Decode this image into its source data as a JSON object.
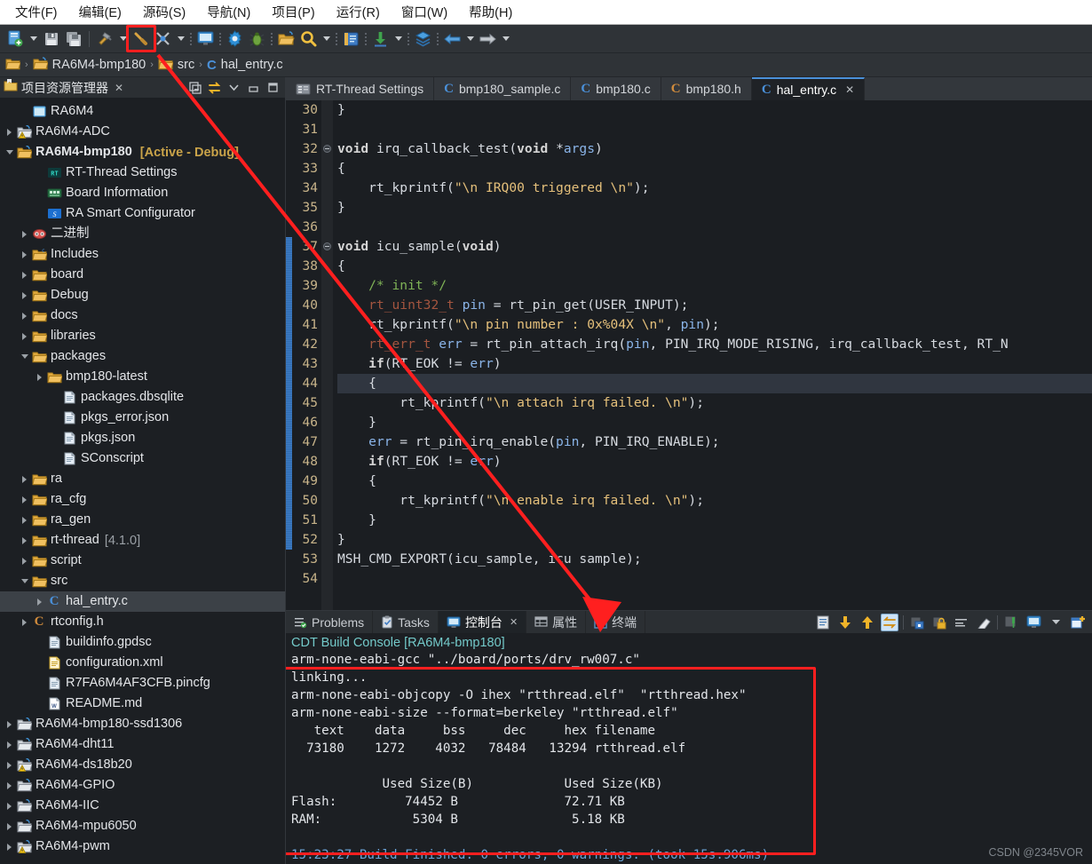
{
  "menubar": {
    "items": [
      {
        "label": "文件(F)",
        "name": "menu-file"
      },
      {
        "label": "编辑(E)",
        "name": "menu-edit"
      },
      {
        "label": "源码(S)",
        "name": "menu-source"
      },
      {
        "label": "导航(N)",
        "name": "menu-navigate"
      },
      {
        "label": "项目(P)",
        "name": "menu-project"
      },
      {
        "label": "运行(R)",
        "name": "menu-run"
      },
      {
        "label": "窗口(W)",
        "name": "menu-window"
      },
      {
        "label": "帮助(H)",
        "name": "menu-help"
      }
    ]
  },
  "toolbar": {
    "highlight_color": "#ff1f1f",
    "icons": [
      "new-file-icon",
      "dropdown-arrow",
      "save-icon",
      "save-all-icon",
      "separator",
      "build-hammer-icon",
      "dropdown-arrow",
      "build-clean-icon",
      "dots",
      "console-monitor-icon",
      "dots",
      "settings-gear-icon",
      "debug-bug-icon",
      "dots",
      "open-folder-icon",
      "search-icon",
      "dropdown-arrow",
      "dots",
      "book-icon",
      "dots",
      "download-icon",
      "dropdown-arrow",
      "dots",
      "layers-icon",
      "dots",
      "back-arrow-icon",
      "dropdown-arrow",
      "forward-arrow-icon",
      "dropdown-arrow"
    ]
  },
  "breadcrumb": {
    "items": [
      "RA6M4-bmp180",
      "src",
      "hal_entry.c"
    ],
    "separator": "›"
  },
  "explorer": {
    "title": "项目资源管理器",
    "close_label": "✕",
    "toolbar_icons": [
      "collapse-all-icon",
      "link-with-editor-icon",
      "view-menu-icon",
      "minimize-icon",
      "maximize-icon"
    ],
    "tree": [
      {
        "indent": 1,
        "twisty": "none",
        "icon": "project-closed-icon",
        "label": "RA6M4"
      },
      {
        "indent": 0,
        "twisty": "closed",
        "icon": "project-warn-icon",
        "label": "RA6M4-ADC"
      },
      {
        "indent": 0,
        "twisty": "open",
        "icon": "project-open-icon",
        "label": "RA6M4-bmp180",
        "bold": true,
        "suffix": "[Active - Debug]"
      },
      {
        "indent": 2,
        "twisty": "none",
        "icon": "rt-thread-icon",
        "label": "RT-Thread Settings"
      },
      {
        "indent": 2,
        "twisty": "none",
        "icon": "board-icon",
        "label": "Board Information"
      },
      {
        "indent": 2,
        "twisty": "none",
        "icon": "ra-smart-icon",
        "label": "RA Smart Configurator"
      },
      {
        "indent": 1,
        "twisty": "closed",
        "icon": "binary-icon",
        "label": "二进制"
      },
      {
        "indent": 1,
        "twisty": "closed",
        "icon": "includes-icon",
        "label": "Includes"
      },
      {
        "indent": 1,
        "twisty": "closed",
        "icon": "folder-icon",
        "label": "board"
      },
      {
        "indent": 1,
        "twisty": "closed",
        "icon": "folder-icon",
        "label": "Debug"
      },
      {
        "indent": 1,
        "twisty": "closed",
        "icon": "folder-icon",
        "label": "docs"
      },
      {
        "indent": 1,
        "twisty": "closed",
        "icon": "folder-icon",
        "label": "libraries"
      },
      {
        "indent": 1,
        "twisty": "open",
        "icon": "folder-icon",
        "label": "packages"
      },
      {
        "indent": 2,
        "twisty": "closed",
        "icon": "folder-icon",
        "label": "bmp180-latest"
      },
      {
        "indent": 3,
        "twisty": "none",
        "icon": "file-icon",
        "label": "packages.dbsqlite"
      },
      {
        "indent": 3,
        "twisty": "none",
        "icon": "file-icon",
        "label": "pkgs_error.json"
      },
      {
        "indent": 3,
        "twisty": "none",
        "icon": "file-icon",
        "label": "pkgs.json"
      },
      {
        "indent": 3,
        "twisty": "none",
        "icon": "file-icon",
        "label": "SConscript"
      },
      {
        "indent": 1,
        "twisty": "closed",
        "icon": "folder-icon",
        "label": "ra"
      },
      {
        "indent": 1,
        "twisty": "closed",
        "icon": "folder-icon",
        "label": "ra_cfg"
      },
      {
        "indent": 1,
        "twisty": "closed",
        "icon": "folder-icon",
        "label": "ra_gen"
      },
      {
        "indent": 1,
        "twisty": "closed",
        "icon": "folder-icon",
        "label": "rt-thread",
        "version": "[4.1.0]"
      },
      {
        "indent": 1,
        "twisty": "closed",
        "icon": "folder-icon",
        "label": "script"
      },
      {
        "indent": 1,
        "twisty": "open",
        "icon": "folder-icon",
        "label": "src"
      },
      {
        "indent": 2,
        "twisty": "closed",
        "icon": "c-source-icon",
        "label": "hal_entry.c",
        "selected": true
      },
      {
        "indent": 1,
        "twisty": "closed",
        "icon": "h-header-icon",
        "label": "rtconfig.h"
      },
      {
        "indent": 2,
        "twisty": "none",
        "icon": "file-icon",
        "label": "buildinfo.gpdsc"
      },
      {
        "indent": 2,
        "twisty": "none",
        "icon": "xml-file-icon",
        "label": "configuration.xml"
      },
      {
        "indent": 2,
        "twisty": "none",
        "icon": "file-icon",
        "label": "R7FA6M4AF3CFB.pincfg"
      },
      {
        "indent": 2,
        "twisty": "none",
        "icon": "md-file-icon",
        "label": "README.md"
      },
      {
        "indent": 0,
        "twisty": "closed",
        "icon": "project-closed2-icon",
        "label": "RA6M4-bmp180-ssd1306"
      },
      {
        "indent": 0,
        "twisty": "closed",
        "icon": "project-closed2-icon",
        "label": "RA6M4-dht11"
      },
      {
        "indent": 0,
        "twisty": "closed",
        "icon": "project-warn-icon",
        "label": "RA6M4-ds18b20"
      },
      {
        "indent": 0,
        "twisty": "closed",
        "icon": "project-closed2-icon",
        "label": "RA6M4-GPIO"
      },
      {
        "indent": 0,
        "twisty": "closed",
        "icon": "project-closed2-icon",
        "label": "RA6M4-IIC"
      },
      {
        "indent": 0,
        "twisty": "closed",
        "icon": "project-closed2-icon",
        "label": "RA6M4-mpu6050"
      },
      {
        "indent": 0,
        "twisty": "closed",
        "icon": "project-warn-icon",
        "label": "RA6M4-pwm"
      }
    ]
  },
  "editor": {
    "tabs": [
      {
        "label": "RT-Thread Settings",
        "icon": "settings-file-icon",
        "active": false
      },
      {
        "label": "bmp180_sample.c",
        "icon": "c-source-icon",
        "active": false
      },
      {
        "label": "bmp180.c",
        "icon": "c-source-icon",
        "active": false
      },
      {
        "label": "bmp180.h",
        "icon": "h-header-icon",
        "active": false
      },
      {
        "label": "hal_entry.c",
        "icon": "c-source-icon",
        "active": true,
        "closable": true
      }
    ],
    "first_line": 30,
    "last_line": 54,
    "highlighted_line": 44,
    "changed_lines": [
      37,
      52
    ],
    "lines": [
      {
        "n": 30,
        "text": "}"
      },
      {
        "n": 31,
        "text": ""
      },
      {
        "n": 32,
        "text": "void irq_callback_test(void *args)",
        "fold": true
      },
      {
        "n": 33,
        "text": "{"
      },
      {
        "n": 34,
        "text": "    rt_kprintf(\"\\n IRQ00 triggered \\n\");"
      },
      {
        "n": 35,
        "text": "}"
      },
      {
        "n": 36,
        "text": ""
      },
      {
        "n": 37,
        "text": "void icu_sample(void)",
        "fold": true
      },
      {
        "n": 38,
        "text": "{"
      },
      {
        "n": 39,
        "text": "    /* init */"
      },
      {
        "n": 40,
        "text": "    rt_uint32_t pin = rt_pin_get(USER_INPUT);"
      },
      {
        "n": 41,
        "text": "    rt_kprintf(\"\\n pin number : 0x%04X \\n\", pin);"
      },
      {
        "n": 42,
        "text": "    rt_err_t err = rt_pin_attach_irq(pin, PIN_IRQ_MODE_RISING, irq_callback_test, RT_N"
      },
      {
        "n": 43,
        "text": "    if(RT_EOK != err)"
      },
      {
        "n": 44,
        "text": "    {"
      },
      {
        "n": 45,
        "text": "        rt_kprintf(\"\\n attach irq failed. \\n\");"
      },
      {
        "n": 46,
        "text": "    }"
      },
      {
        "n": 47,
        "text": "    err = rt_pin_irq_enable(pin, PIN_IRQ_ENABLE);"
      },
      {
        "n": 48,
        "text": "    if(RT_EOK != err)"
      },
      {
        "n": 49,
        "text": "    {"
      },
      {
        "n": 50,
        "text": "        rt_kprintf(\"\\n enable irq failed. \\n\");"
      },
      {
        "n": 51,
        "text": "    }"
      },
      {
        "n": 52,
        "text": "}"
      },
      {
        "n": 53,
        "text": "MSH_CMD_EXPORT(icu_sample, icu sample);"
      },
      {
        "n": 54,
        "text": ""
      }
    ]
  },
  "bottom_panel": {
    "tabs": [
      {
        "label": "Problems",
        "icon": "problems-icon",
        "active": false
      },
      {
        "label": "Tasks",
        "icon": "tasks-icon",
        "active": false
      },
      {
        "label": "控制台",
        "icon": "console-icon",
        "active": true,
        "closable": true
      },
      {
        "label": "属性",
        "icon": "properties-icon",
        "active": false
      },
      {
        "label": "终端",
        "icon": "terminal-icon",
        "active": false
      }
    ],
    "toolbar_icons": [
      "clear-console-icon",
      "scroll-down-icon",
      "scroll-up-icon",
      "toggle-wrap-icon",
      "separator",
      "save-console-icon",
      "lock-console-icon",
      "show-selected-icon",
      "clear-icon",
      "separator",
      "pin-console-icon",
      "display-selected-console-icon",
      "dropdown-arrow",
      "open-console-icon"
    ],
    "console_title": "CDT Build Console [RA6M4-bmp180]",
    "highlight_color": "#ff1f1f",
    "lines": [
      {
        "text": "arm-none-eabi-gcc \"../board/ports/drv_rw007.c\"",
        "style": "normal"
      },
      {
        "text": "linking...",
        "style": "normal"
      },
      {
        "text": "arm-none-eabi-objcopy -O ihex \"rtthread.elf\"  \"rtthread.hex\"",
        "style": "normal"
      },
      {
        "text": "arm-none-eabi-size --format=berkeley \"rtthread.elf\"",
        "style": "normal"
      },
      {
        "text": "   text    data     bss     dec     hex filename",
        "style": "normal"
      },
      {
        "text": "  73180    1272    4032   78484   13294 rtthread.elf",
        "style": "normal"
      },
      {
        "text": "",
        "style": "normal"
      },
      {
        "text": "            Used Size(B)            Used Size(KB)",
        "style": "normal"
      },
      {
        "text": "Flash:         74452 B              72.71 KB",
        "style": "normal"
      },
      {
        "text": "RAM:            5304 B               5.18 KB",
        "style": "normal"
      },
      {
        "text": "",
        "style": "normal"
      },
      {
        "text": "15:23:27 Build Finished. 0 errors, 0 warnings. (took 15s.906ms)",
        "style": "blue"
      }
    ]
  },
  "watermark": "CSDN @2345VOR"
}
